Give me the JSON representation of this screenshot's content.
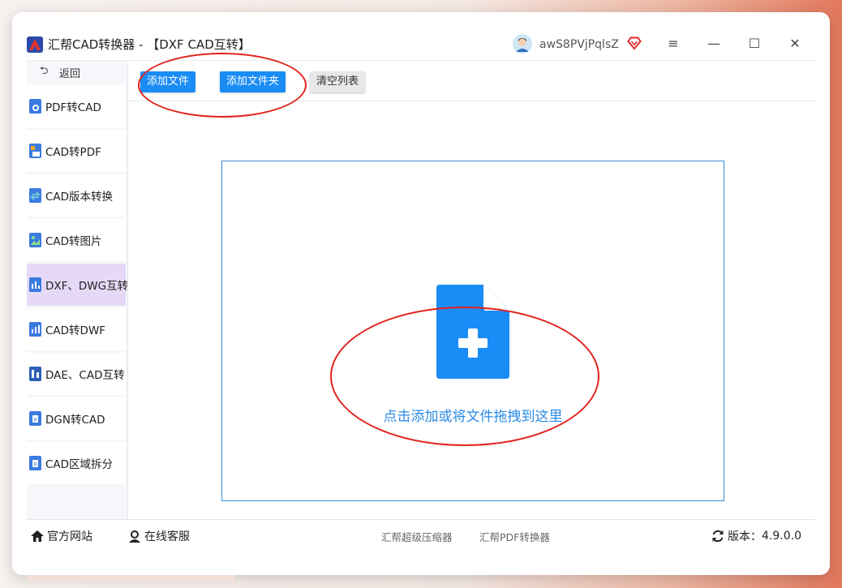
{
  "window": {
    "title": "汇帮CAD转换器 - 【DXF CAD互转】",
    "username": "awS8PVjPqlsZ",
    "menu_icon": "≡",
    "minimize_icon": "—",
    "maximize_icon": "☐",
    "close_icon": "✕"
  },
  "sidebar": {
    "back_label": "返回",
    "items": [
      {
        "label": "PDF转CAD",
        "icon": "pdf-to-cad-icon"
      },
      {
        "label": "CAD转PDF",
        "icon": "cad-to-pdf-icon"
      },
      {
        "label": "CAD版本转换",
        "icon": "cad-version-icon"
      },
      {
        "label": "CAD转图片",
        "icon": "cad-to-image-icon"
      },
      {
        "label": "DXF、DWG互转",
        "icon": "dxf-dwg-icon",
        "active": true
      },
      {
        "label": "CAD转DWF",
        "icon": "cad-to-dwf-icon"
      },
      {
        "label": "DAE、CAD互转",
        "icon": "dae-cad-icon"
      },
      {
        "label": "DGN转CAD",
        "icon": "dgn-to-cad-icon"
      },
      {
        "label": "CAD区域拆分",
        "icon": "cad-split-icon"
      }
    ]
  },
  "toolbar": {
    "add_file": "添加文件",
    "add_folder": "添加文件夹",
    "clear_list": "清空列表"
  },
  "dropzone": {
    "text": "点击添加或将文件拖拽到这里"
  },
  "footer": {
    "website": "官方网站",
    "service": "在线客服",
    "compressor": "汇帮超级压缩器",
    "pdf_converter": "汇帮PDF转换器",
    "version_label": "版本：",
    "version_value": "4.9.0.0"
  },
  "colors": {
    "accent": "#1a8cf5",
    "active_nav": "#e6d9f7",
    "annotation": "#e0221c",
    "drop_text": "#2b8be6"
  }
}
